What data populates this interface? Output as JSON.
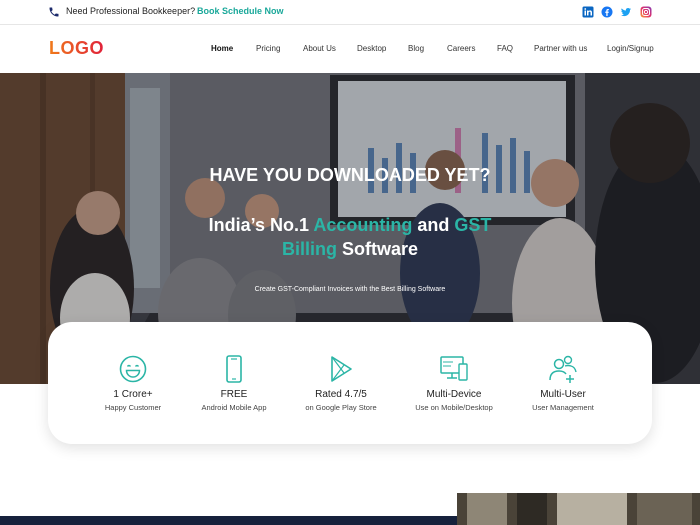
{
  "topbar": {
    "icon": "phone-icon",
    "prompt": "Need Professional Bookkeeper?",
    "cta": "Book Schedule Now",
    "social": [
      "linkedin-icon",
      "facebook-icon",
      "twitter-icon",
      "instagram-icon"
    ]
  },
  "nav": {
    "logo": "LOGO",
    "items": [
      "Home",
      "Pricing",
      "About Us",
      "Desktop",
      "Blog",
      "Careers",
      "FAQ",
      "Partner with us",
      "Login/Signup"
    ],
    "active": "Home"
  },
  "hero": {
    "title": "HAVE YOU DOWNLOADED YET?",
    "h1_part1": "India’s No.1 ",
    "h1_accent1": "Accounting",
    "h1_part2": " and ",
    "h1_accent2": "GST Billing",
    "h1_part3": " Software",
    "subtitle": "Create GST-Compliant Invoices with the Best Billing Software"
  },
  "stats": [
    {
      "icon": "smiley-icon",
      "main": "1 Crore+",
      "sub": "Happy Customer"
    },
    {
      "icon": "mobile-icon",
      "main": "FREE",
      "sub": "Android Mobile App"
    },
    {
      "icon": "play-store-icon",
      "main": "Rated 4.7/5",
      "sub": "on Google Play Store"
    },
    {
      "icon": "multi-device-icon",
      "main": "Multi-Device",
      "sub": "Use on Mobile/Desktop"
    },
    {
      "icon": "multi-user-icon",
      "main": "Multi-User",
      "sub": "User Management"
    }
  ],
  "colors": {
    "accent": "#2bb5a6",
    "logo_from": "#f07a1a",
    "logo_to": "#e0203a",
    "dark_footer": "#16213c"
  }
}
